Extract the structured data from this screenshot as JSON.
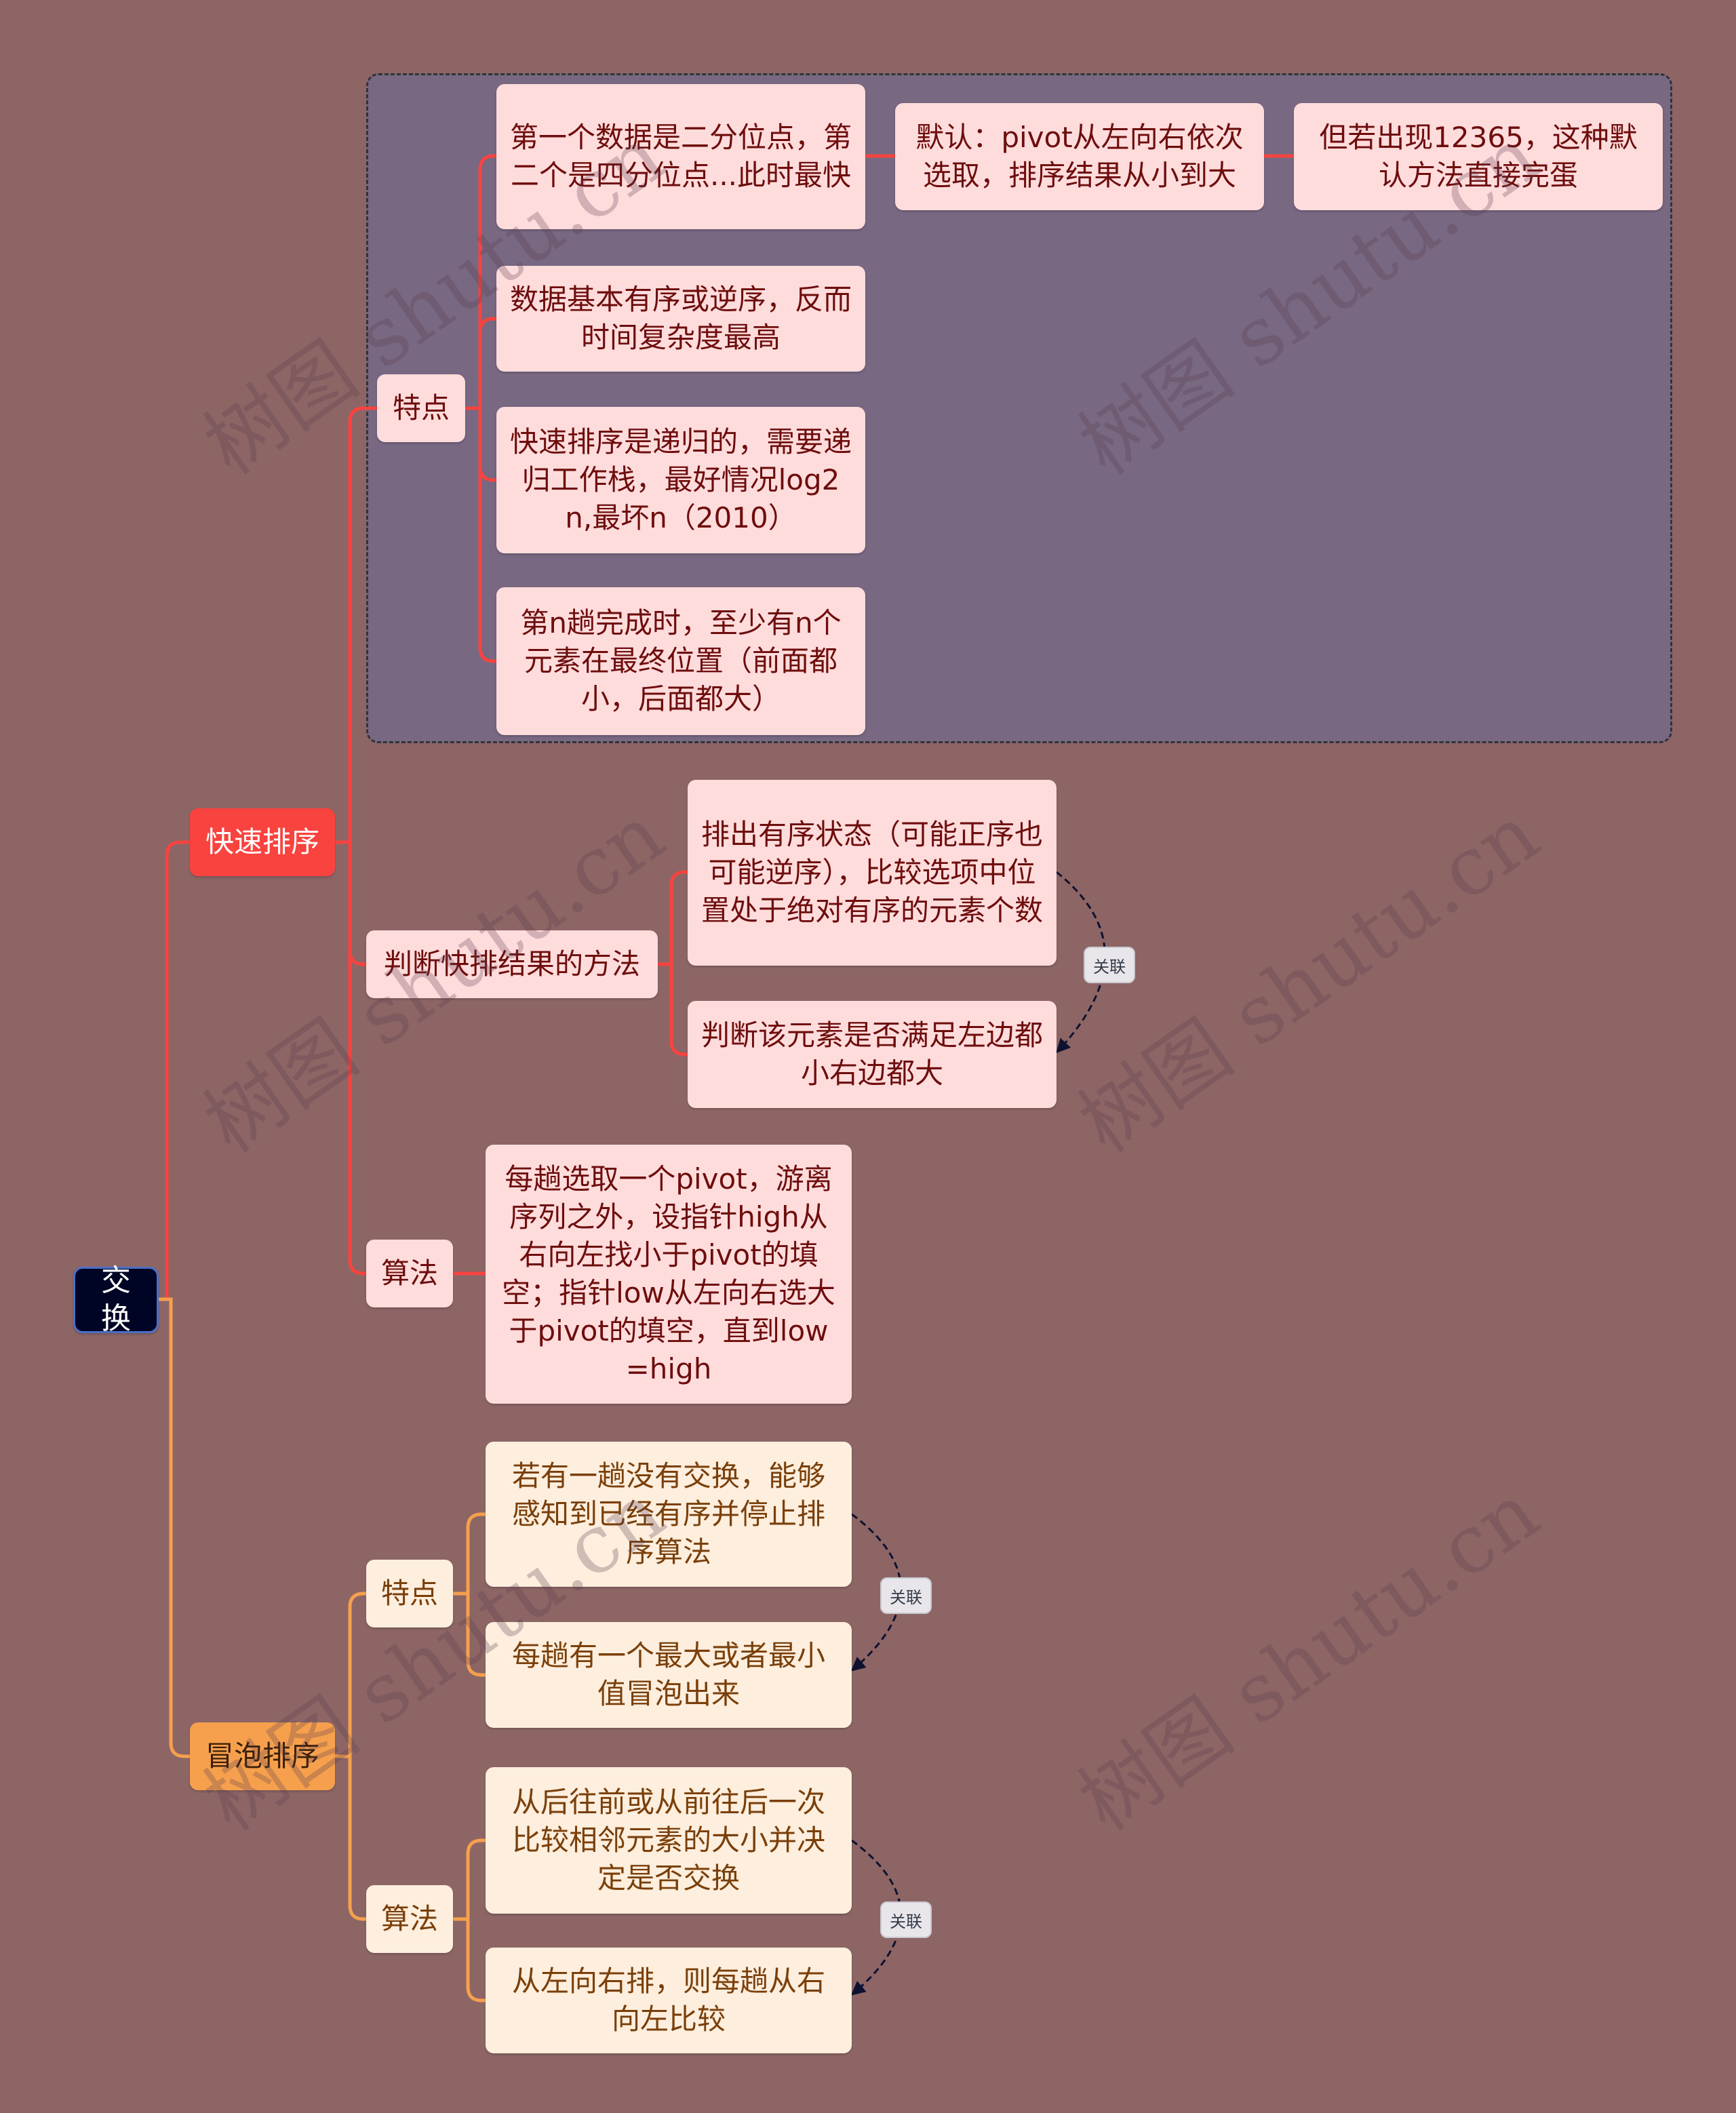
{
  "watermark": "树图 shutu.cn",
  "colors": {
    "background": "#8d6565",
    "group_fill": "#786882",
    "quick_branch": "#f9433f",
    "bubble_branch": "#f6a04d",
    "root_fill": "#000525",
    "relation_line": "#0e1230"
  },
  "root": {
    "label": "交换"
  },
  "quicksort": {
    "label": "快速排序",
    "features": {
      "label": "特点",
      "items": [
        "第一个数据是二分位点，第二个是四分位点...此时最快",
        "数据基本有序或逆序，反而时间复杂度最高",
        "快速排序是递归的，需要递归工作栈，最好情况log2n,最坏n（2010）",
        "第n趟完成时，至少有n个元素在最终位置（前面都小，后面都大）"
      ],
      "first_chain": [
        "默认：pivot从左向右依次选取，排序结果从小到大",
        "但若出现12365，这种默认方法直接完蛋"
      ]
    },
    "judge": {
      "label": "判断快排结果的方法",
      "items": [
        "排出有序状态（可能正序也可能逆序），比较选项中位置处于绝对有序的元素个数",
        "判断该元素是否满足左边都小右边都大"
      ],
      "relation_label": "关联"
    },
    "algorithm": {
      "label": "算法",
      "text": "每趟选取一个pivot，游离序列之外，设指针high从右向左找小于pivot的填空；指针low从左向右选大于pivot的填空，直到low=high"
    }
  },
  "bubblesort": {
    "label": "冒泡排序",
    "features": {
      "label": "特点",
      "items": [
        "若有一趟没有交换，能够感知到已经有序并停止排序算法",
        "每趟有一个最大或者最小值冒泡出来"
      ],
      "relation_label": "关联"
    },
    "algorithm": {
      "label": "算法",
      "items": [
        "从后往前或从前往后一次比较相邻元素的大小并决定是否交换",
        "从左向右排，则每趟从右向左比较"
      ],
      "relation_label": "关联"
    }
  }
}
